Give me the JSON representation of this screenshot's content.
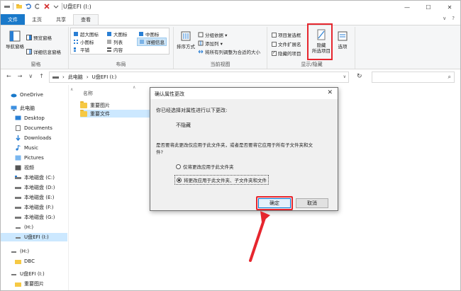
{
  "window": {
    "title": "U盘EFI (I:)",
    "controls": {
      "minimize": "—",
      "maximize": "☐",
      "close": "✕"
    }
  },
  "tabs": [
    {
      "label": "文件"
    },
    {
      "label": "主页"
    },
    {
      "label": "共享"
    },
    {
      "label": "查看"
    }
  ],
  "tabs_right": {
    "collapse": "∨",
    "help": "?"
  },
  "ribbon": {
    "panes": {
      "nav_pane": "导航窗格",
      "preview_pane": "预览窗格",
      "details_pane": "详细信息窗格",
      "label": "窗格"
    },
    "layout": {
      "items": [
        "超大图标",
        "大图标",
        "中图标",
        "小图标",
        "列表",
        "详细信息",
        "平铺",
        "内容"
      ],
      "label": "布局"
    },
    "current_view": {
      "sort_by": "排序方式",
      "group_by": "分组依据 ▾",
      "add_columns": "添加列 ▾",
      "size_columns": "将所有列调整为合适的大小",
      "label": "当前视图"
    },
    "show_hide": {
      "item_checkboxes": "项目复选框",
      "file_extensions": "文件扩展名",
      "hidden_items": "隐藏的项目",
      "hide_selected_line1": "隐藏",
      "hide_selected_line2": "所选项目",
      "options": "选项",
      "label": "显示/隐藏"
    }
  },
  "address": {
    "crumbs": [
      "此电脑",
      "U盘EFI (I:)"
    ],
    "back": "←",
    "forward": "→",
    "recent": "∨",
    "up": "↑",
    "refresh": "↻",
    "search_icon": "⌕"
  },
  "nav_items": [
    {
      "label": "OneDrive"
    },
    {
      "label": "此电脑"
    },
    {
      "label": "Desktop"
    },
    {
      "label": "Documents"
    },
    {
      "label": "Downloads"
    },
    {
      "label": "Music"
    },
    {
      "label": "Pictures"
    },
    {
      "label": "视频"
    },
    {
      "label": "本地磁盘 (C:)"
    },
    {
      "label": "本地磁盘 (D:)"
    },
    {
      "label": "本地磁盘 (E:)"
    },
    {
      "label": "本地磁盘 (F:)"
    },
    {
      "label": "本地磁盘 (G:)"
    },
    {
      "label": "(H:)"
    },
    {
      "label": "U盘EFI (I:)"
    },
    {
      "label": "(H:)"
    },
    {
      "label": "DBC"
    },
    {
      "label": "U盘EFI (I:)"
    },
    {
      "label": "重要图片"
    }
  ],
  "content": {
    "column_name": "名称",
    "files": [
      "重要图片",
      "重要文件"
    ]
  },
  "dialog": {
    "title": "确认属性更改",
    "line1": "你已经选择对属性进行以下更改:",
    "change": "不隐藏",
    "question_line1": "是否要将此更改仅应用于此文件夹，或者是否要将它应用于所有子文件夹和文",
    "question_line2": "件?",
    "option1": "仅将更改应用于此文件夹",
    "option2": "将更改应用于此文件夹、子文件夹和文件",
    "ok": "确定",
    "cancel": "取消"
  },
  "colors": {
    "file_tab": "#1979ca",
    "selection": "#cce8ff",
    "highlight_red": "#e6262e",
    "folder": "#f6c944"
  }
}
